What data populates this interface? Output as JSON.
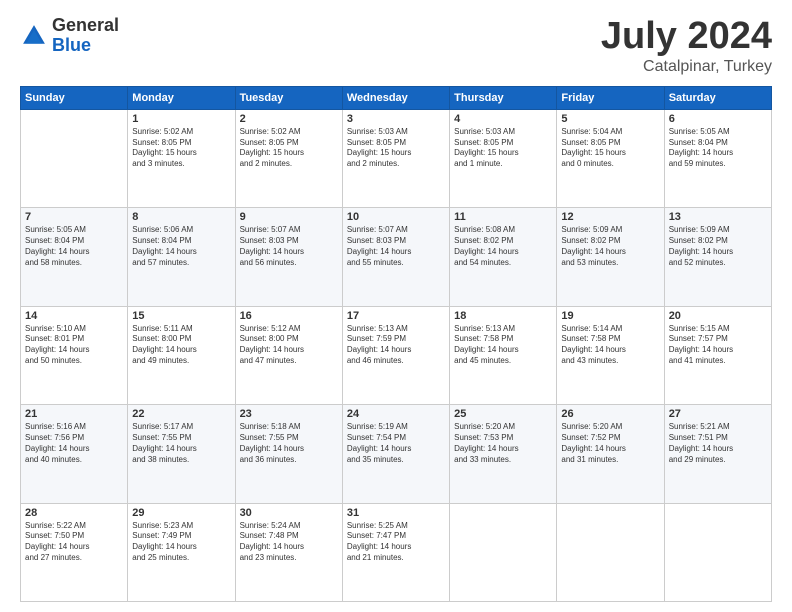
{
  "header": {
    "logo_general": "General",
    "logo_blue": "Blue",
    "month": "July 2024",
    "location": "Catalpinar, Turkey"
  },
  "days_of_week": [
    "Sunday",
    "Monday",
    "Tuesday",
    "Wednesday",
    "Thursday",
    "Friday",
    "Saturday"
  ],
  "weeks": [
    [
      {
        "day": "",
        "info": ""
      },
      {
        "day": "1",
        "info": "Sunrise: 5:02 AM\nSunset: 8:05 PM\nDaylight: 15 hours\nand 3 minutes."
      },
      {
        "day": "2",
        "info": "Sunrise: 5:02 AM\nSunset: 8:05 PM\nDaylight: 15 hours\nand 2 minutes."
      },
      {
        "day": "3",
        "info": "Sunrise: 5:03 AM\nSunset: 8:05 PM\nDaylight: 15 hours\nand 2 minutes."
      },
      {
        "day": "4",
        "info": "Sunrise: 5:03 AM\nSunset: 8:05 PM\nDaylight: 15 hours\nand 1 minute."
      },
      {
        "day": "5",
        "info": "Sunrise: 5:04 AM\nSunset: 8:05 PM\nDaylight: 15 hours\nand 0 minutes."
      },
      {
        "day": "6",
        "info": "Sunrise: 5:05 AM\nSunset: 8:04 PM\nDaylight: 14 hours\nand 59 minutes."
      }
    ],
    [
      {
        "day": "7",
        "info": "Sunrise: 5:05 AM\nSunset: 8:04 PM\nDaylight: 14 hours\nand 58 minutes."
      },
      {
        "day": "8",
        "info": "Sunrise: 5:06 AM\nSunset: 8:04 PM\nDaylight: 14 hours\nand 57 minutes."
      },
      {
        "day": "9",
        "info": "Sunrise: 5:07 AM\nSunset: 8:03 PM\nDaylight: 14 hours\nand 56 minutes."
      },
      {
        "day": "10",
        "info": "Sunrise: 5:07 AM\nSunset: 8:03 PM\nDaylight: 14 hours\nand 55 minutes."
      },
      {
        "day": "11",
        "info": "Sunrise: 5:08 AM\nSunset: 8:02 PM\nDaylight: 14 hours\nand 54 minutes."
      },
      {
        "day": "12",
        "info": "Sunrise: 5:09 AM\nSunset: 8:02 PM\nDaylight: 14 hours\nand 53 minutes."
      },
      {
        "day": "13",
        "info": "Sunrise: 5:09 AM\nSunset: 8:02 PM\nDaylight: 14 hours\nand 52 minutes."
      }
    ],
    [
      {
        "day": "14",
        "info": "Sunrise: 5:10 AM\nSunset: 8:01 PM\nDaylight: 14 hours\nand 50 minutes."
      },
      {
        "day": "15",
        "info": "Sunrise: 5:11 AM\nSunset: 8:00 PM\nDaylight: 14 hours\nand 49 minutes."
      },
      {
        "day": "16",
        "info": "Sunrise: 5:12 AM\nSunset: 8:00 PM\nDaylight: 14 hours\nand 47 minutes."
      },
      {
        "day": "17",
        "info": "Sunrise: 5:13 AM\nSunset: 7:59 PM\nDaylight: 14 hours\nand 46 minutes."
      },
      {
        "day": "18",
        "info": "Sunrise: 5:13 AM\nSunset: 7:58 PM\nDaylight: 14 hours\nand 45 minutes."
      },
      {
        "day": "19",
        "info": "Sunrise: 5:14 AM\nSunset: 7:58 PM\nDaylight: 14 hours\nand 43 minutes."
      },
      {
        "day": "20",
        "info": "Sunrise: 5:15 AM\nSunset: 7:57 PM\nDaylight: 14 hours\nand 41 minutes."
      }
    ],
    [
      {
        "day": "21",
        "info": "Sunrise: 5:16 AM\nSunset: 7:56 PM\nDaylight: 14 hours\nand 40 minutes."
      },
      {
        "day": "22",
        "info": "Sunrise: 5:17 AM\nSunset: 7:55 PM\nDaylight: 14 hours\nand 38 minutes."
      },
      {
        "day": "23",
        "info": "Sunrise: 5:18 AM\nSunset: 7:55 PM\nDaylight: 14 hours\nand 36 minutes."
      },
      {
        "day": "24",
        "info": "Sunrise: 5:19 AM\nSunset: 7:54 PM\nDaylight: 14 hours\nand 35 minutes."
      },
      {
        "day": "25",
        "info": "Sunrise: 5:20 AM\nSunset: 7:53 PM\nDaylight: 14 hours\nand 33 minutes."
      },
      {
        "day": "26",
        "info": "Sunrise: 5:20 AM\nSunset: 7:52 PM\nDaylight: 14 hours\nand 31 minutes."
      },
      {
        "day": "27",
        "info": "Sunrise: 5:21 AM\nSunset: 7:51 PM\nDaylight: 14 hours\nand 29 minutes."
      }
    ],
    [
      {
        "day": "28",
        "info": "Sunrise: 5:22 AM\nSunset: 7:50 PM\nDaylight: 14 hours\nand 27 minutes."
      },
      {
        "day": "29",
        "info": "Sunrise: 5:23 AM\nSunset: 7:49 PM\nDaylight: 14 hours\nand 25 minutes."
      },
      {
        "day": "30",
        "info": "Sunrise: 5:24 AM\nSunset: 7:48 PM\nDaylight: 14 hours\nand 23 minutes."
      },
      {
        "day": "31",
        "info": "Sunrise: 5:25 AM\nSunset: 7:47 PM\nDaylight: 14 hours\nand 21 minutes."
      },
      {
        "day": "",
        "info": ""
      },
      {
        "day": "",
        "info": ""
      },
      {
        "day": "",
        "info": ""
      }
    ]
  ]
}
